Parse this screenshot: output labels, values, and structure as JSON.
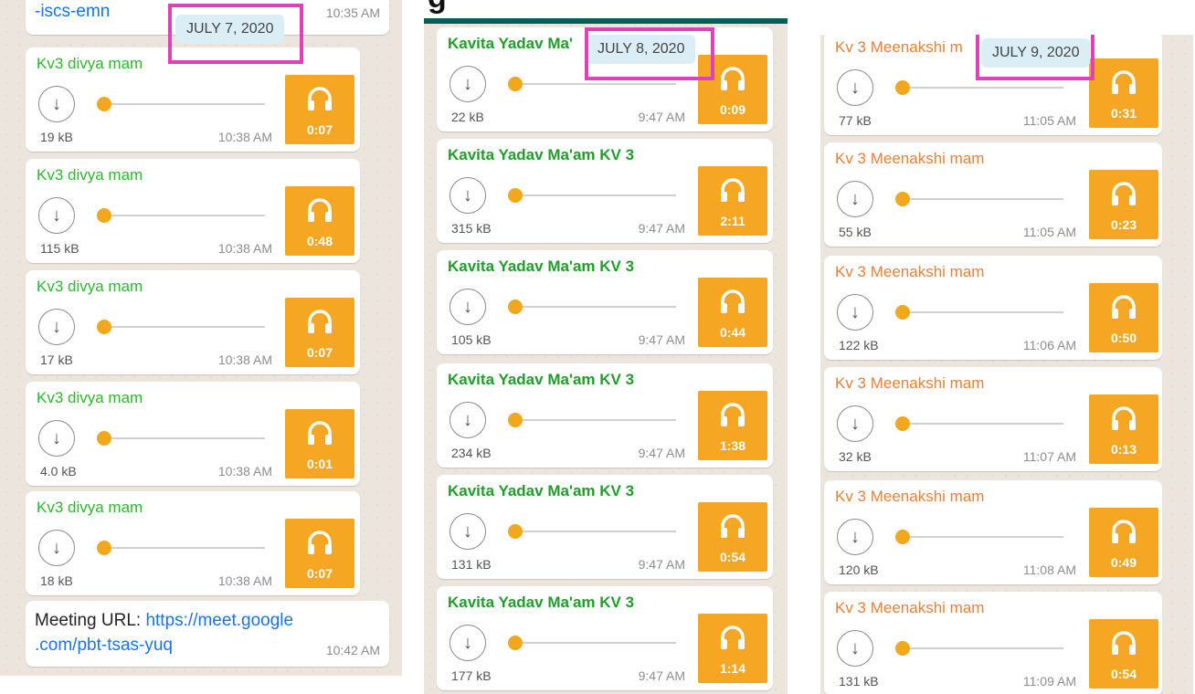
{
  "heading_fragment": "g",
  "panels": [
    {
      "date": "JULY 7, 2020",
      "top_message": {
        "text": "-iscs-emn",
        "time": "10:35 AM"
      },
      "messages": [
        {
          "sender": "Kv3 divya mam",
          "size": "19 kB",
          "time": "10:38 AM",
          "duration": "0:07"
        },
        {
          "sender": "Kv3 divya mam",
          "size": "115 kB",
          "time": "10:38 AM",
          "duration": "0:48"
        },
        {
          "sender": "Kv3 divya mam",
          "size": "17 kB",
          "time": "10:38 AM",
          "duration": "0:07"
        },
        {
          "sender": "Kv3 divya mam",
          "size": "4.0 kB",
          "time": "10:38 AM",
          "duration": "0:01"
        },
        {
          "sender": "Kv3 divya mam",
          "size": "18 kB",
          "time": "10:38 AM",
          "duration": "0:07"
        }
      ],
      "meeting": {
        "label": "Meeting URL: ",
        "link_line1": "https://meet.google",
        "link_line2": ".com/pbt-tsas-yuq",
        "time": "10:42 AM"
      }
    },
    {
      "date": "JULY 8, 2020",
      "messages": [
        {
          "sender": "Kavita Yadav Ma'",
          "size": "22 kB",
          "time": "9:47 AM",
          "duration": "0:09"
        },
        {
          "sender": "Kavita Yadav Ma'am KV 3",
          "size": "315 kB",
          "time": "9:47 AM",
          "duration": "2:11"
        },
        {
          "sender": "Kavita Yadav Ma'am KV 3",
          "size": "105 kB",
          "time": "9:47 AM",
          "duration": "0:44"
        },
        {
          "sender": "Kavita Yadav Ma'am KV 3",
          "size": "234 kB",
          "time": "9:47 AM",
          "duration": "1:38"
        },
        {
          "sender": "Kavita Yadav Ma'am KV 3",
          "size": "131 kB",
          "time": "9:47 AM",
          "duration": "0:54"
        },
        {
          "sender": "Kavita Yadav Ma'am KV 3",
          "size": "177 kB",
          "time": "9:47 AM",
          "duration": "1:14"
        }
      ]
    },
    {
      "date": "JULY 9, 2020",
      "messages": [
        {
          "sender": "Kv 3 Meenakshi m",
          "size": "77 kB",
          "time": "11:05 AM",
          "duration": "0:31"
        },
        {
          "sender": "Kv 3 Meenakshi mam",
          "size": "55 kB",
          "time": "11:05 AM",
          "duration": "0:23"
        },
        {
          "sender": "Kv 3 Meenakshi mam",
          "size": "122 kB",
          "time": "11:06 AM",
          "duration": "0:50"
        },
        {
          "sender": "Kv 3 Meenakshi mam",
          "size": "32 kB",
          "time": "11:07 AM",
          "duration": "0:13"
        },
        {
          "sender": "Kv 3 Meenakshi mam",
          "size": "120 kB",
          "time": "11:08 AM",
          "duration": "0:49"
        },
        {
          "sender": "Kv 3 Meenakshi mam",
          "size": "131 kB",
          "time": "11:09 AM",
          "duration": "0:54"
        }
      ]
    }
  ],
  "colors": {
    "chat_background": "#ece5dd",
    "voice_tile": "#f5a623",
    "highlight_box": "#e040b8",
    "date_pill": "#dbeef5",
    "link": "#1a73e8"
  },
  "icons": [
    "download-icon",
    "headphones-icon",
    "playback-position-dot"
  ]
}
